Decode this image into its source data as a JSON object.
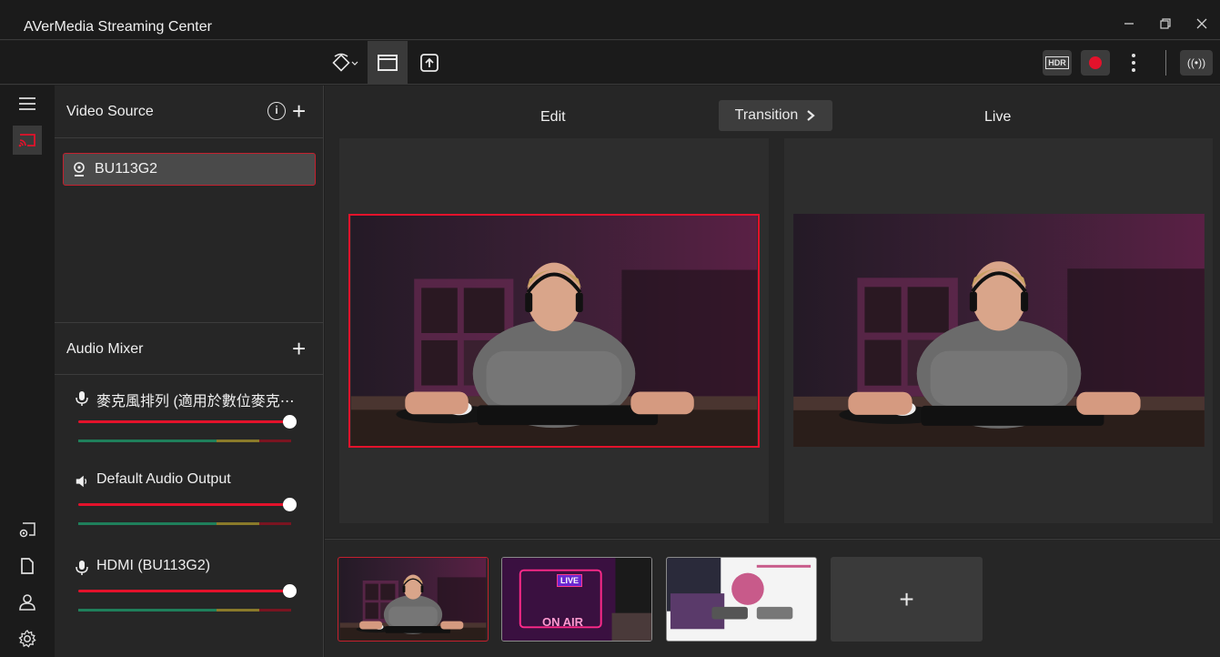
{
  "window": {
    "title": "AVerMedia Streaming Center",
    "minimize_icon": "minimize-icon",
    "restore_icon": "restore-icon",
    "close_icon": "close-icon"
  },
  "toolbar": {
    "orientation_icon": "rotate-icon",
    "layout_icon": "window-layout-icon",
    "export_icon": "upload-icon",
    "hdr_label": "HDR",
    "record_icon": "record-icon",
    "more_icon": "more-vertical-icon",
    "live_label": "((•))"
  },
  "sidebar": {
    "items": [
      "menu-icon",
      "cast-icon",
      "device-settings-icon",
      "document-icon",
      "user-icon",
      "settings-icon"
    ]
  },
  "video_source": {
    "title": "Video Source",
    "items": [
      {
        "label": "BU113G2",
        "icon": "webcam-icon"
      }
    ]
  },
  "audio_mixer": {
    "title": "Audio Mixer",
    "channels": [
      {
        "name": "麥克風排列 (適用於數位麥克⋯",
        "icon": "microphone-icon",
        "volume": 1.0
      },
      {
        "name": "Default Audio Output",
        "icon": "speaker-icon",
        "volume": 1.0
      },
      {
        "name": "HDMI (BU113G2)",
        "icon": "microphone-icon",
        "volume": 1.0
      }
    ]
  },
  "main": {
    "edit_label": "Edit",
    "live_label": "Live",
    "transition_label": "Transition"
  },
  "scenes": {
    "thumbnails": [
      {
        "name": "scene-gamer",
        "active": true
      },
      {
        "name": "scene-on-air",
        "active": false,
        "texts": [
          "LIVE",
          "ON AIR"
        ]
      },
      {
        "name": "scene-product",
        "active": false
      }
    ],
    "add_label": "+"
  },
  "colors": {
    "accent": "#e3122b",
    "bg": "#262626",
    "titlebar": "#1b1b1b"
  }
}
